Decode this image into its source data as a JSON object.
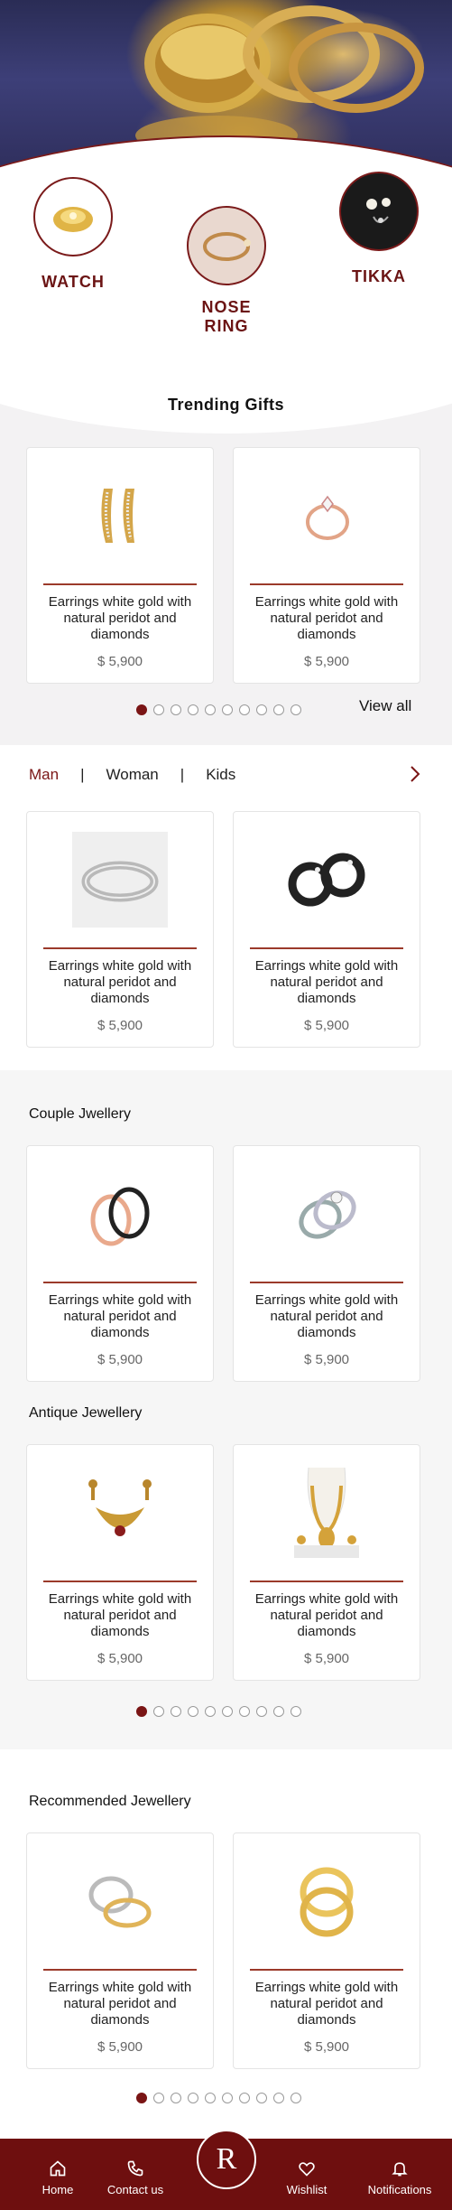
{
  "hero": {
    "categories": [
      {
        "label": "WATCH"
      },
      {
        "label": "NOSE RING"
      },
      {
        "label": "TIKKA"
      }
    ]
  },
  "trending": {
    "title": "Trending Gifts",
    "view_all": "View all",
    "products": [
      {
        "name": "Earrings white gold with natural peridot and diamonds",
        "price": "$ 5,900",
        "icon": "earrings"
      },
      {
        "name": "Earrings white gold with natural peridot and diamonds",
        "price": "$ 5,900",
        "icon": "rose-gold-ring"
      }
    ]
  },
  "gender_tabs": {
    "tabs": [
      "Man",
      "Woman",
      "Kids"
    ],
    "separator": "|",
    "active": "Man",
    "products": [
      {
        "name": "Earrings white gold with natural peridot and diamonds",
        "price": "$ 5,900",
        "icon": "silver-band"
      },
      {
        "name": "Earrings white gold with natural peridot and diamonds",
        "price": "$ 5,900",
        "icon": "black-hoops"
      }
    ]
  },
  "couple": {
    "title": "Couple Jwellery",
    "products": [
      {
        "name": "Earrings white gold with natural peridot and diamonds",
        "price": "$ 5,900",
        "icon": "couple-bracelets"
      },
      {
        "name": "Earrings white gold with natural peridot and diamonds",
        "price": "$ 5,900",
        "icon": "couple-rings"
      }
    ]
  },
  "antique": {
    "title": "Antique Jewellery",
    "products": [
      {
        "name": "Earrings white gold with natural peridot and diamonds",
        "price": "$ 5,900",
        "icon": "antique-set"
      },
      {
        "name": "Earrings white gold with natural peridot and diamonds",
        "price": "$ 5,900",
        "icon": "gold-necklace"
      }
    ]
  },
  "recommended": {
    "title": "Recommended Jewellery",
    "products": [
      {
        "name": "Earrings white gold with natural peridot and diamonds",
        "price": "$ 5,900",
        "icon": "name-rings"
      },
      {
        "name": "Earrings white gold with natural peridot and diamonds",
        "price": "$ 5,900",
        "icon": "gold-bangles"
      }
    ]
  },
  "pagination": {
    "total": 10,
    "active_index": 0
  },
  "bottom_nav": {
    "home": "Home",
    "contact": "Contact us",
    "logo": "R",
    "wishlist": "Wishlist",
    "notifications": "Notifications"
  },
  "colors": {
    "brand": "#6e0f0f",
    "accent_line": "#9b3a2a"
  }
}
